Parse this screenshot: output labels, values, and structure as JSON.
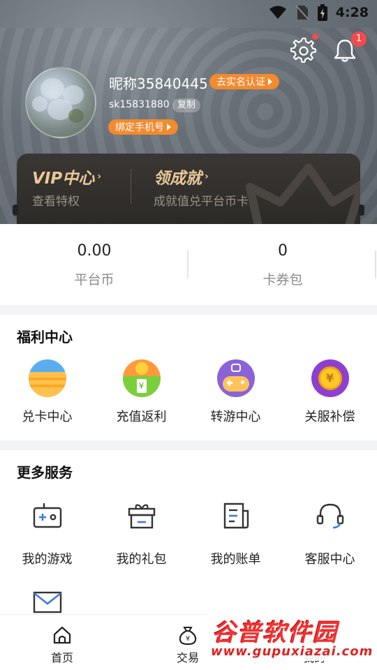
{
  "status_bar": {
    "time": "4:28"
  },
  "header": {
    "notification_count": "1",
    "nickname": "昵称35840445",
    "realname_label": "去实名认证",
    "user_id": "sk15831880",
    "copy_label": "复制",
    "bind_phone_label": "绑定手机号",
    "vip": {
      "title": "VIP中心",
      "subtitle": "查看特权"
    },
    "achievement": {
      "title": "领成就",
      "subtitle": "成就值兑平台币卡"
    }
  },
  "stats": [
    {
      "value": "0.00",
      "label": "平台币"
    },
    {
      "value": "0",
      "label": "卡券包"
    }
  ],
  "welfare": {
    "title": "福利中心",
    "items": [
      {
        "label": "兑卡中心",
        "icon": "card-exchange-icon"
      },
      {
        "label": "充值返利",
        "icon": "recharge-rebate-icon"
      },
      {
        "label": "转游中心",
        "icon": "game-transfer-icon"
      },
      {
        "label": "关服补偿",
        "icon": "server-compensation-icon"
      }
    ]
  },
  "services": {
    "title": "更多服务",
    "items": [
      {
        "label": "我的游戏",
        "icon": "gamepad-icon"
      },
      {
        "label": "我的礼包",
        "icon": "gift-icon"
      },
      {
        "label": "我的账单",
        "icon": "bill-icon"
      },
      {
        "label": "客服中心",
        "icon": "headset-icon"
      }
    ],
    "extra_icon": "mail-icon"
  },
  "bottom_nav": [
    {
      "label": "首页",
      "icon": "home-icon"
    },
    {
      "label": "交易",
      "icon": "money-bag-icon"
    },
    {
      "label": "我的",
      "icon": "user-icon"
    }
  ],
  "watermark": {
    "title": "谷普软件园",
    "url": "www.gupuxiazai.com"
  },
  "colors": {
    "accent": "#f28a2e",
    "badge": "#f24b4b",
    "vip_gold": "#e9c89a"
  }
}
